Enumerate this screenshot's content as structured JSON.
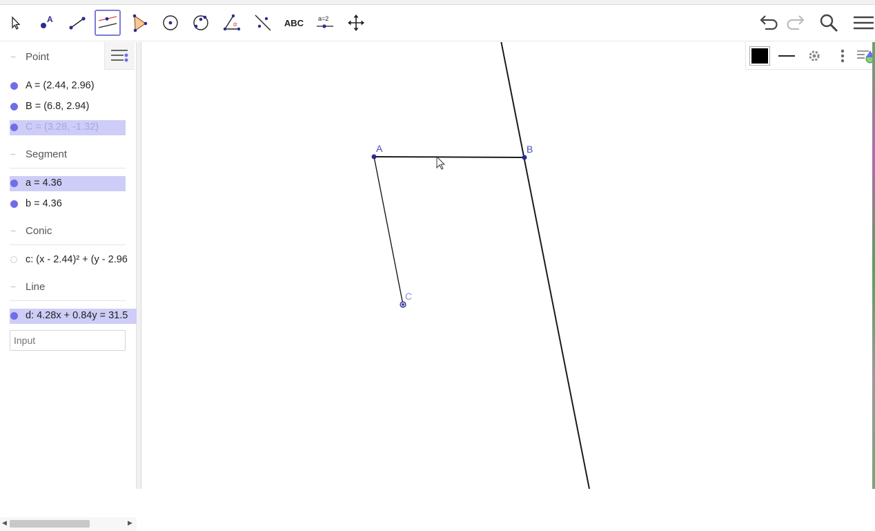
{
  "toolbar": {
    "tools": [
      {
        "name": "move-tool",
        "active": false
      },
      {
        "name": "point-tool",
        "active": false,
        "glyph": "A"
      },
      {
        "name": "segment-tool",
        "active": false
      },
      {
        "name": "parallel-line-tool",
        "active": true
      },
      {
        "name": "polygon-tool",
        "active": false
      },
      {
        "name": "circle-center-point-tool",
        "active": false
      },
      {
        "name": "circle-three-points-tool",
        "active": false
      },
      {
        "name": "angle-tool",
        "active": false,
        "glyph": "α"
      },
      {
        "name": "reflect-tool",
        "active": false
      },
      {
        "name": "text-tool",
        "active": false,
        "glyph": "ABC"
      },
      {
        "name": "slider-tool",
        "active": false,
        "glyph": "a=2"
      },
      {
        "name": "move-graphics-tool",
        "active": false
      }
    ],
    "right_icons": [
      "undo-icon",
      "redo-icon",
      "search-icon",
      "menu-icon"
    ]
  },
  "algebra": {
    "categories": {
      "point": "Point",
      "segment": "Segment",
      "conic": "Conic",
      "line": "Line"
    },
    "points": [
      {
        "label": "A = (2.44, 2.96)",
        "selected": false,
        "faded": false
      },
      {
        "label": "B = (6.8, 2.94)",
        "selected": false,
        "faded": false
      },
      {
        "label": "C = (3.28, -1.32)",
        "selected": true,
        "faded": true
      }
    ],
    "segments": [
      {
        "label": "a = 4.36",
        "selected": true
      },
      {
        "label": "b = 4.36",
        "selected": false
      }
    ],
    "conics": [
      {
        "label": "c: (x - 2.44)² + (y - 2.96",
        "visible": false
      }
    ],
    "lines": [
      {
        "label": "d: 4.28x + 0.84y = 31.5",
        "selected": true
      }
    ],
    "input_placeholder": "Input"
  },
  "graphics": {
    "points": {
      "A": {
        "label": "A"
      },
      "B": {
        "label": "B"
      },
      "C": {
        "label": "C"
      }
    },
    "style_bar": {
      "color": "#000000",
      "icons": [
        "color-swatch-icon",
        "line-style-icon",
        "gear-icon",
        "more-vert-icon",
        "view-toggle-icon"
      ]
    }
  },
  "colors": {
    "accent": "#6e6ee8",
    "selection": "#cdcdf7",
    "point_label": "#4a4ac0"
  }
}
